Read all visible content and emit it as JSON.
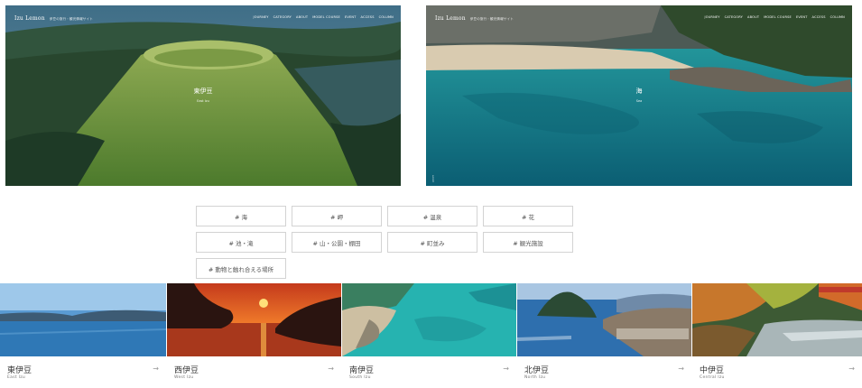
{
  "site": {
    "logo": "Izu Lemon",
    "logo_sub": "伊豆の旅行・観光情報サイト"
  },
  "nav": [
    "JOURNEY",
    "CATEGORY",
    "ABOUT",
    "MODEL COURSE",
    "EVENT",
    "ACCESS",
    "COLUMN"
  ],
  "hero_left": {
    "title": "東伊豆",
    "subtitle": "East Izu"
  },
  "hero_right": {
    "title": "海",
    "subtitle": "Sea",
    "vertical": "scroll"
  },
  "tags": [
    "# 海",
    "# 岬",
    "# 温泉",
    "# 花",
    "# 池・滝",
    "# 山・公園・棚田",
    "# 町並み",
    "# 観光施設",
    "# 動物と触れ合える場所"
  ],
  "regions": [
    {
      "name": "東伊豆",
      "en": "East Izu",
      "arrow": "→"
    },
    {
      "name": "西伊豆",
      "en": "West Izu",
      "arrow": "→"
    },
    {
      "name": "南伊豆",
      "en": "South Izu",
      "arrow": "→"
    },
    {
      "name": "北伊豆",
      "en": "North Izu",
      "arrow": "→"
    },
    {
      "name": "中伊豆",
      "en": "Central Izu",
      "arrow": "→"
    }
  ]
}
